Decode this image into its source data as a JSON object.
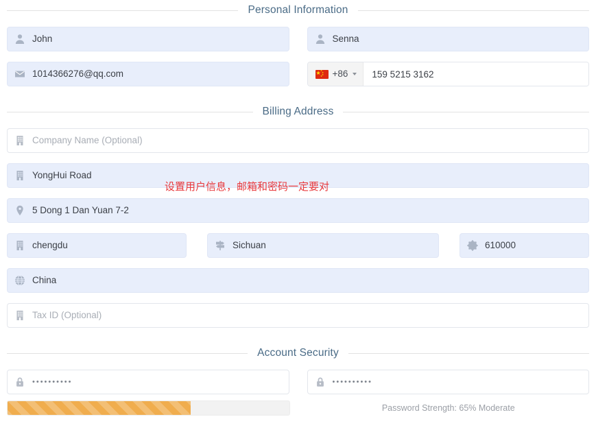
{
  "sections": {
    "personal": {
      "title": "Personal Information"
    },
    "billing": {
      "title": "Billing Address"
    },
    "security": {
      "title": "Account Security"
    }
  },
  "personal": {
    "first_name": {
      "icon": "user-icon",
      "value": "John"
    },
    "last_name": {
      "icon": "user-icon",
      "value": "Senna"
    },
    "email": {
      "icon": "envelope-icon",
      "value": "1014366276@qq.com"
    },
    "phone": {
      "icon": "flag-cn-icon",
      "country_code": "+86",
      "value": "159 5215 3162"
    }
  },
  "billing": {
    "company": {
      "icon": "building-icon",
      "placeholder": "Company Name (Optional)",
      "value": ""
    },
    "street": {
      "icon": "building-icon",
      "value": "YongHui Road"
    },
    "address2": {
      "icon": "map-pin-icon",
      "value": "5 Dong 1 Dan Yuan 7-2"
    },
    "city": {
      "icon": "building-icon",
      "value": "chengdu"
    },
    "state": {
      "icon": "map-signs-icon",
      "value": "Sichuan"
    },
    "zip": {
      "icon": "zip-circle-icon",
      "value": "610000"
    },
    "country": {
      "icon": "globe-icon",
      "value": "China"
    },
    "tax_id": {
      "icon": "building-icon",
      "placeholder": "Tax ID (Optional)",
      "value": ""
    }
  },
  "security": {
    "password": {
      "icon": "lock-icon",
      "value": "••••••••••"
    },
    "confirm_password": {
      "icon": "lock-icon",
      "value": "••••••••••"
    },
    "strength": {
      "percent": 65,
      "label": "Password Strength: 65% Moderate",
      "color": "#f0ad4e"
    }
  },
  "annotation": {
    "text": "设置用户信息，邮箱和密码一定要对",
    "color": "#e8393c"
  }
}
